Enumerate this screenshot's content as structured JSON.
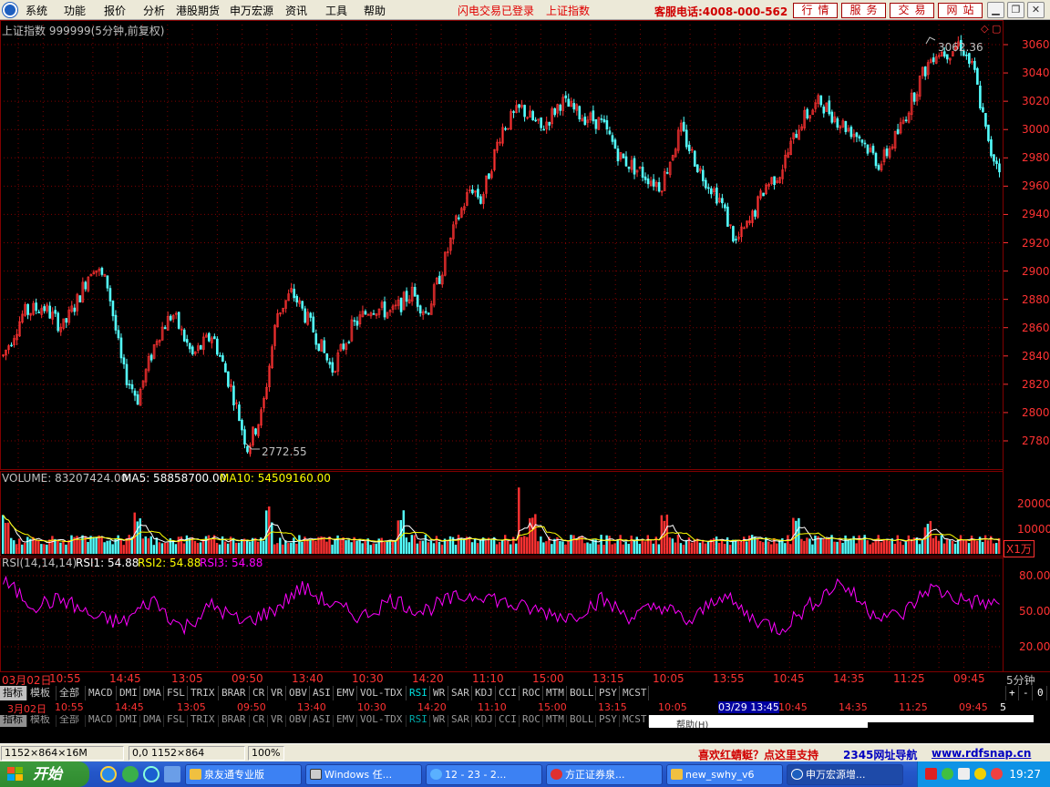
{
  "menubar": {
    "items": [
      "系统",
      "功能",
      "报价",
      "分析",
      "港股期货",
      "申万宏源",
      "资讯",
      "工具",
      "帮助"
    ],
    "status": [
      "闪电交易已登录",
      "上证指数"
    ],
    "hotline": "客服电话:4008-000-562",
    "buttons": [
      "行情",
      "服务",
      "交易",
      "网站"
    ],
    "window_buttons": [
      "minimize-icon",
      "restore-icon",
      "close-icon"
    ]
  },
  "chart": {
    "header": "上证指数 999999(5分钟,前复权)",
    "high_label": "3062.36",
    "low_label": "2772.55",
    "price_axis": [
      "3060",
      "3040",
      "3020",
      "3000",
      "2980",
      "2960",
      "2940",
      "2920",
      "2900",
      "2880",
      "2860",
      "2840",
      "2820",
      "2800",
      "2780"
    ],
    "volume_header": {
      "prefix": "VOLUME: 83207424.00",
      "ma5": "MA5: 58858700.00",
      "ma10": "MA10: 54509160.00"
    },
    "volume_axis": [
      "20000",
      "10000"
    ],
    "volume_unit": "X1万",
    "rsi_header": {
      "prefix": "RSI(14,14,14)",
      "rsi1": "RSI1: 54.88",
      "rsi2": "RSI2: 54.88",
      "rsi3": "RSI3: 54.88"
    },
    "rsi_axis": [
      "80.00",
      "50.00",
      "20.00"
    ],
    "time_axis": [
      "03月02日",
      "10:55",
      "14:45",
      "13:05",
      "09:50",
      "13:40",
      "10:30",
      "14:20",
      "11:10",
      "15:00",
      "13:15",
      "10:05",
      "13:55",
      "10:45",
      "14:35",
      "11:25",
      "09:45"
    ],
    "period": "5分钟",
    "colors": {
      "up": "#ff3232",
      "down": "#54ffff",
      "grid": "#800000",
      "rsi": "#ff00ff",
      "ma5": "#ffffff",
      "ma10": "#ffff00",
      "axis_text": "#ff3232"
    }
  },
  "tabs": {
    "items": [
      "指标",
      "模板",
      "全部",
      "MACD",
      "DMI",
      "DMA",
      "FSL",
      "TRIX",
      "BRAR",
      "CR",
      "VR",
      "OBV",
      "ASI",
      "EMV",
      "VOL-TDX",
      "RSI",
      "WR",
      "SAR",
      "KDJ",
      "CCI",
      "ROC",
      "MTM",
      "BOLL",
      "PSY",
      "MCST"
    ],
    "active": "RSI",
    "right_buttons": [
      "+",
      "-",
      "0"
    ]
  },
  "ghost": {
    "time_axis": [
      "3月02日",
      "10:55",
      "14:45",
      "13:05",
      "09:50",
      "13:40",
      "10:30",
      "14:20",
      "11:10",
      "15:00",
      "13:15",
      "10:05",
      "03/29 13:45",
      "10:45",
      "14:35",
      "11:25",
      "09:45"
    ],
    "right_label": "5",
    "submenu_hint": "帮助(H)"
  },
  "statusbar": {
    "cells": [
      "1152×864×16M",
      "0,0 1152×864",
      "100%"
    ],
    "promo": "喜欢红蜻蜓？点这里支持",
    "nav": "2345网址导航",
    "site": "www.rdfsnap.cn"
  },
  "taskbar": {
    "start": "开始",
    "tasks": [
      "泉友通专业版",
      "Windows 任...",
      "12 - 23 - 2...",
      "方正证券泉...",
      "new_swhy_v6",
      "申万宏源增..."
    ],
    "clock": "19:27"
  },
  "chart_data": [
    {
      "type": "candlestick",
      "title": "上证指数 999999(5分钟,前复权)",
      "ylim": [
        2760,
        3070
      ],
      "y_ticks": [
        2780,
        2800,
        2820,
        2840,
        2860,
        2880,
        2900,
        2920,
        2940,
        2960,
        2980,
        3000,
        3020,
        3040,
        3060
      ],
      "x_ticks": [
        "03月02日",
        "10:55",
        "14:45",
        "13:05",
        "09:50",
        "13:40",
        "10:30",
        "14:20",
        "11:10",
        "15:00",
        "13:15",
        "10:05",
        "13:55",
        "10:45",
        "14:35",
        "11:25",
        "09:45"
      ],
      "path_x": [
        0,
        0.02,
        0.04,
        0.06,
        0.075,
        0.09,
        0.105,
        0.12,
        0.135,
        0.155,
        0.17,
        0.19,
        0.21,
        0.23,
        0.245,
        0.26,
        0.275,
        0.29,
        0.31,
        0.33,
        0.35,
        0.37,
        0.39,
        0.41,
        0.425,
        0.44,
        0.455,
        0.47,
        0.48,
        0.5,
        0.52,
        0.54,
        0.56,
        0.58,
        0.6,
        0.62,
        0.64,
        0.66,
        0.68,
        0.7,
        0.72,
        0.735,
        0.75,
        0.765,
        0.78,
        0.8,
        0.82,
        0.84,
        0.86,
        0.88,
        0.9,
        0.92,
        0.935,
        0.95,
        0.96,
        0.975,
        0.99,
        1.0
      ],
      "path_y": [
        2840,
        2870,
        2875,
        2860,
        2880,
        2905,
        2890,
        2830,
        2810,
        2855,
        2870,
        2840,
        2855,
        2815,
        2775,
        2800,
        2870,
        2885,
        2860,
        2830,
        2860,
        2875,
        2870,
        2885,
        2870,
        2900,
        2935,
        2960,
        2950,
        3000,
        3015,
        3000,
        3020,
        3010,
        3005,
        2980,
        2970,
        2960,
        3000,
        2970,
        2950,
        2920,
        2935,
        2960,
        2970,
        3005,
        3020,
        3005,
        2995,
        2975,
        3000,
        3035,
        3055,
        3055,
        3062,
        3040,
        2985,
        2975
      ],
      "high": 3062.36,
      "low": 2772.55
    },
    {
      "type": "bar",
      "title": "VOLUME",
      "ylabel": "X1万",
      "y_ticks": [
        10000,
        20000
      ],
      "series": [
        {
          "name": "VOLUME",
          "last": 83207424.0
        },
        {
          "name": "MA5",
          "last": 58858700.0
        },
        {
          "name": "MA10",
          "last": 54509160.0
        }
      ]
    },
    {
      "type": "line",
      "title": "RSI(14,14,14)",
      "ylim": [
        0,
        100
      ],
      "y_ticks": [
        20,
        50,
        80
      ],
      "series": [
        {
          "name": "RSI1",
          "last": 54.88
        },
        {
          "name": "RSI2",
          "last": 54.88
        },
        {
          "name": "RSI3",
          "last": 54.88
        }
      ],
      "path_x": [
        0,
        0.03,
        0.06,
        0.09,
        0.12,
        0.15,
        0.18,
        0.21,
        0.24,
        0.27,
        0.3,
        0.33,
        0.36,
        0.39,
        0.42,
        0.45,
        0.48,
        0.51,
        0.54,
        0.57,
        0.6,
        0.63,
        0.66,
        0.69,
        0.72,
        0.75,
        0.78,
        0.81,
        0.84,
        0.87,
        0.9,
        0.93,
        0.96,
        1.0
      ],
      "path_y": [
        75,
        55,
        60,
        45,
        40,
        60,
        35,
        55,
        40,
        50,
        70,
        55,
        45,
        60,
        50,
        60,
        65,
        55,
        50,
        45,
        60,
        45,
        55,
        40,
        65,
        45,
        35,
        55,
        75,
        50,
        45,
        70,
        60,
        55
      ]
    }
  ]
}
